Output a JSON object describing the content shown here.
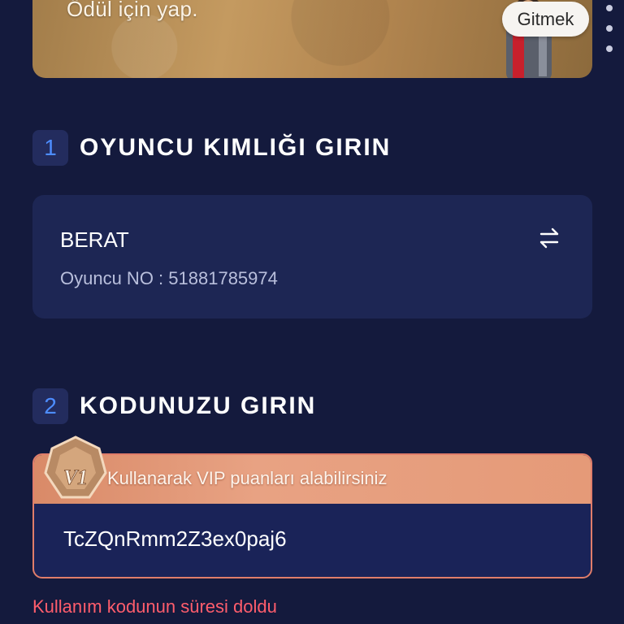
{
  "banner": {
    "text": "Ödül için yap.",
    "button_label": "Gitmek"
  },
  "step1": {
    "number": "1",
    "title": "OYUNCU KIMLIĞI GIRIN"
  },
  "player": {
    "name": "BERAT",
    "id_label": "Oyuncu NO : ",
    "id_value": "51881785974"
  },
  "step2": {
    "number": "2",
    "title": "KODUNUZU GIRIN"
  },
  "code": {
    "vip_badge": "V1",
    "vip_text": "Kullanarak VIP puanları alabilirsiniz",
    "value": "TcZQnRmm2Z3ex0paj6"
  },
  "error": {
    "message": "Kullanım kodunun süresi doldu"
  },
  "colors": {
    "background": "#141a3d",
    "card": "#1d2654",
    "accent_blue": "#4d8dff",
    "error_red": "#ff5d6c",
    "vip_orange": "#e59a78"
  }
}
